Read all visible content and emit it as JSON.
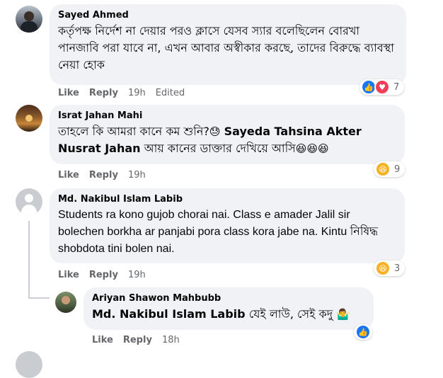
{
  "comments": [
    {
      "author": "Sayed Ahmed",
      "text": "কর্তৃপক্ষ নির্দেশ না দেয়ার পরও ক্লাসে যেসব স্যার বলেছিলেন বোরখা পানজাবি পরা যাবে না, এখন আবার অস্বীকার করছে, তাদের বিরুদ্ধে ব্যাবস্থা নেয়া হোক",
      "like": "Like",
      "reply": "Reply",
      "time": "19h",
      "edited": "Edited",
      "reaction_count": "7",
      "reaction_icons": [
        "like-icon",
        "love-icon"
      ]
    },
    {
      "author": "Israt Jahan Mahi",
      "text_before": "তাহলে কি আমরা কানে কম শুনি?",
      "tag": "Sayeda Tahsina Akter Nusrat Jahan",
      "text_after": " আয় কানের ডাক্তার দেখিয়ে আসি",
      "emoji_before_tag": "😓",
      "emoji_after": "😆😆😆",
      "like": "Like",
      "reply": "Reply",
      "time": "19h",
      "reaction_count": "9",
      "reaction_icons": [
        "haha-icon"
      ]
    },
    {
      "author": "Md. Nakibul Islam Labib",
      "text": "Students ra kono gujob chorai nai. Class e amader Jalil sir bolechen borkha ar panjabi pora class kora jabe na. Kintu নিষিদ্ধ shobdota tini bolen nai.",
      "like": "Like",
      "reply": "Reply",
      "time": "19h",
      "reaction_count": "3",
      "reaction_icons": [
        "haha-icon"
      ]
    },
    {
      "author": "Ariyan Shawon Mahbubb",
      "tag": "Md. Nakibul Islam Labib",
      "text_after": " যেই লাউ, সেই কদু ",
      "emoji_after": "🤷‍♂️",
      "like": "Like",
      "reply": "Reply",
      "time": "18h",
      "reaction_icons": [
        "like-icon"
      ]
    }
  ],
  "colors": {
    "bubble": "#f0f2f5",
    "like_blue": "#1877f2",
    "love_red": "#f33e58",
    "haha_yellow": "#f7b125",
    "meta_gray": "#65676b"
  }
}
